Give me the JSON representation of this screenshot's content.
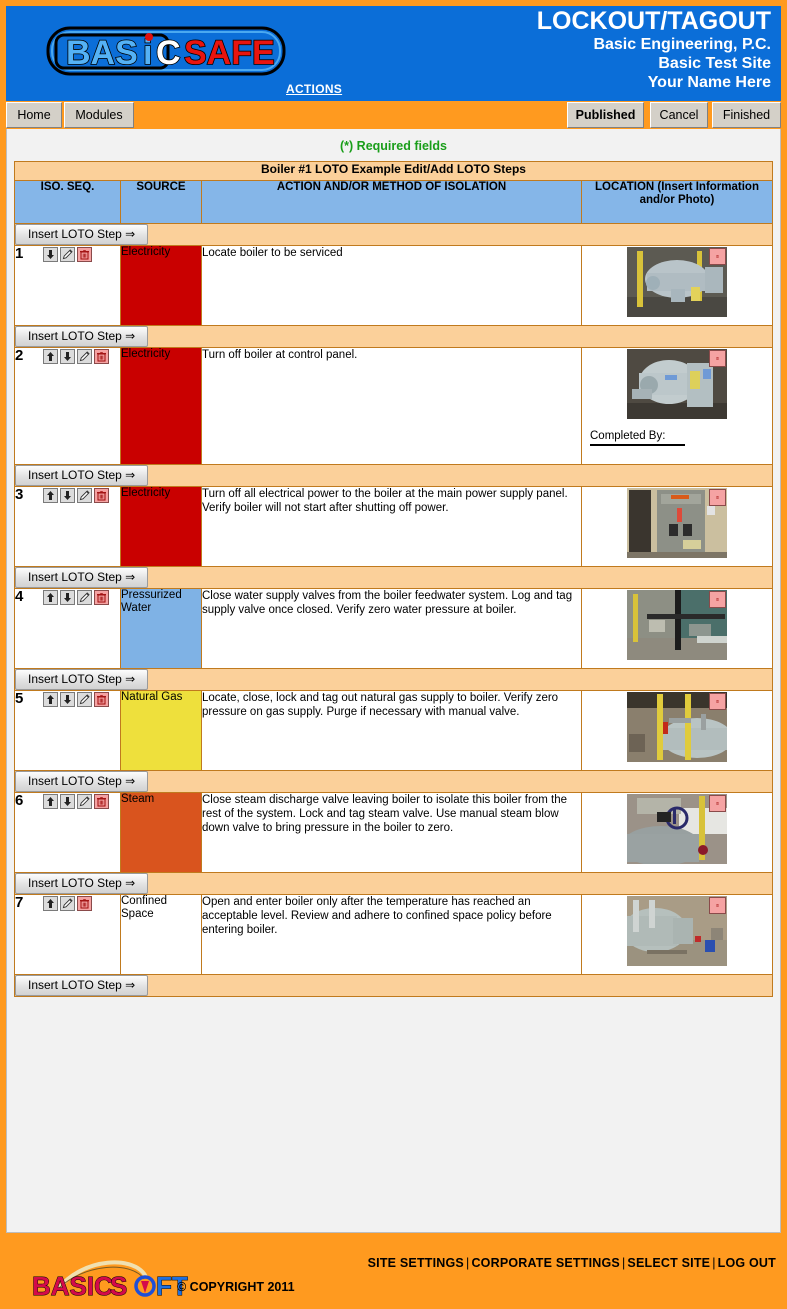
{
  "header": {
    "logo_text_1": "BAS",
    "logo_text_i": "i",
    "logo_text_2": "C",
    "logo_text_3": "SAFE",
    "actions_label": "ACTIONS",
    "title": "LOCKOUT/TAGOUT",
    "company": "Basic Engineering, P.C.",
    "site": "Basic Test Site",
    "user": "Your Name Here"
  },
  "nav": {
    "home": "Home",
    "modules": "Modules",
    "published": "Published",
    "cancel": "Cancel",
    "finished": "Finished"
  },
  "content": {
    "required_note": "(*) Required fields",
    "table_title": "Boiler #1 LOTO Example Edit/Add LOTO Steps",
    "insert_button": "Insert LOTO Step ⇒",
    "completed_by_label": "Completed By:",
    "columns": [
      "ISO. SEQ.",
      "SOURCE",
      "ACTION AND/OR METHOD OF ISOLATION",
      "LOCATION (Insert Information and/or Photo)"
    ],
    "steps": [
      {
        "seq": "1",
        "source": "Electricity",
        "source_color": "#c90000",
        "action": "Locate boiler to be serviced",
        "icons": [
          "down-arrow",
          "edit-pencil",
          "delete-trash"
        ],
        "photo": "boiler-overview",
        "has_completed_by": false
      },
      {
        "seq": "2",
        "source": "Electricity",
        "source_color": "#c90000",
        "action": "Turn off boiler at control panel.",
        "icons": [
          "up-arrow",
          "down-arrow",
          "edit-pencil",
          "delete-trash"
        ],
        "photo": "boiler-control-panel",
        "has_completed_by": true
      },
      {
        "seq": "3",
        "source": "Electricity",
        "source_color": "#c90000",
        "action": "Turn off all electrical power to the boiler at the main power supply panel. Verify boiler will not start after shutting off power.",
        "icons": [
          "up-arrow",
          "down-arrow",
          "edit-pencil",
          "delete-trash"
        ],
        "photo": "electrical-panel",
        "has_completed_by": false
      },
      {
        "seq": "4",
        "source": "Pressurized Water",
        "source_color": "#7fb2e5",
        "action": "Close water supply valves from the boiler feedwater system. Log and tag supply valve once closed. Verify zero water pressure at boiler.",
        "icons": [
          "up-arrow",
          "down-arrow",
          "edit-pencil",
          "delete-trash"
        ],
        "photo": "water-piping",
        "has_completed_by": false
      },
      {
        "seq": "5",
        "source": "Natural Gas",
        "source_color": "#eee03c",
        "action": "Locate, close, lock and tag out natural gas supply to boiler. Verify zero pressure on gas supply. Purge if necessary with manual valve.",
        "icons": [
          "up-arrow",
          "down-arrow",
          "edit-pencil",
          "delete-trash"
        ],
        "photo": "gas-line",
        "has_completed_by": false
      },
      {
        "seq": "6",
        "source": "Steam",
        "source_color": "#d9541e",
        "action": "Close steam discharge valve leaving boiler to isolate this boiler from the rest of the system. Lock and tag steam valve. Use manual steam blow down valve to bring pressure in the boiler to zero.",
        "icons": [
          "up-arrow",
          "down-arrow",
          "edit-pencil",
          "delete-trash"
        ],
        "photo": "steam-valve",
        "has_completed_by": false
      },
      {
        "seq": "7",
        "source": "Confined Space",
        "source_color": "#ffffff",
        "action": "Open and enter boiler only after the temperature has reached an acceptable level. Review and adhere to confined space policy before entering boiler.",
        "icons": [
          "up-arrow",
          "edit-pencil",
          "delete-trash"
        ],
        "photo": "boiler-room",
        "has_completed_by": false
      }
    ]
  },
  "footer": {
    "logo_basic": "BASIC",
    "logo_s": "S",
    "logo_ft": "FT",
    "copyright": "© COPYRIGHT 2011",
    "links": [
      "SITE SETTINGS",
      "CORPORATE SETTINGS",
      "SELECT SITE",
      "LOG OUT"
    ]
  },
  "colors": {
    "brand_orange": "#ff9a1f",
    "brand_blue": "#0b6ed8",
    "table_header_blue": "#85b6e8",
    "band_peach": "#fbd09a",
    "required_green": "#1a9e1a"
  }
}
